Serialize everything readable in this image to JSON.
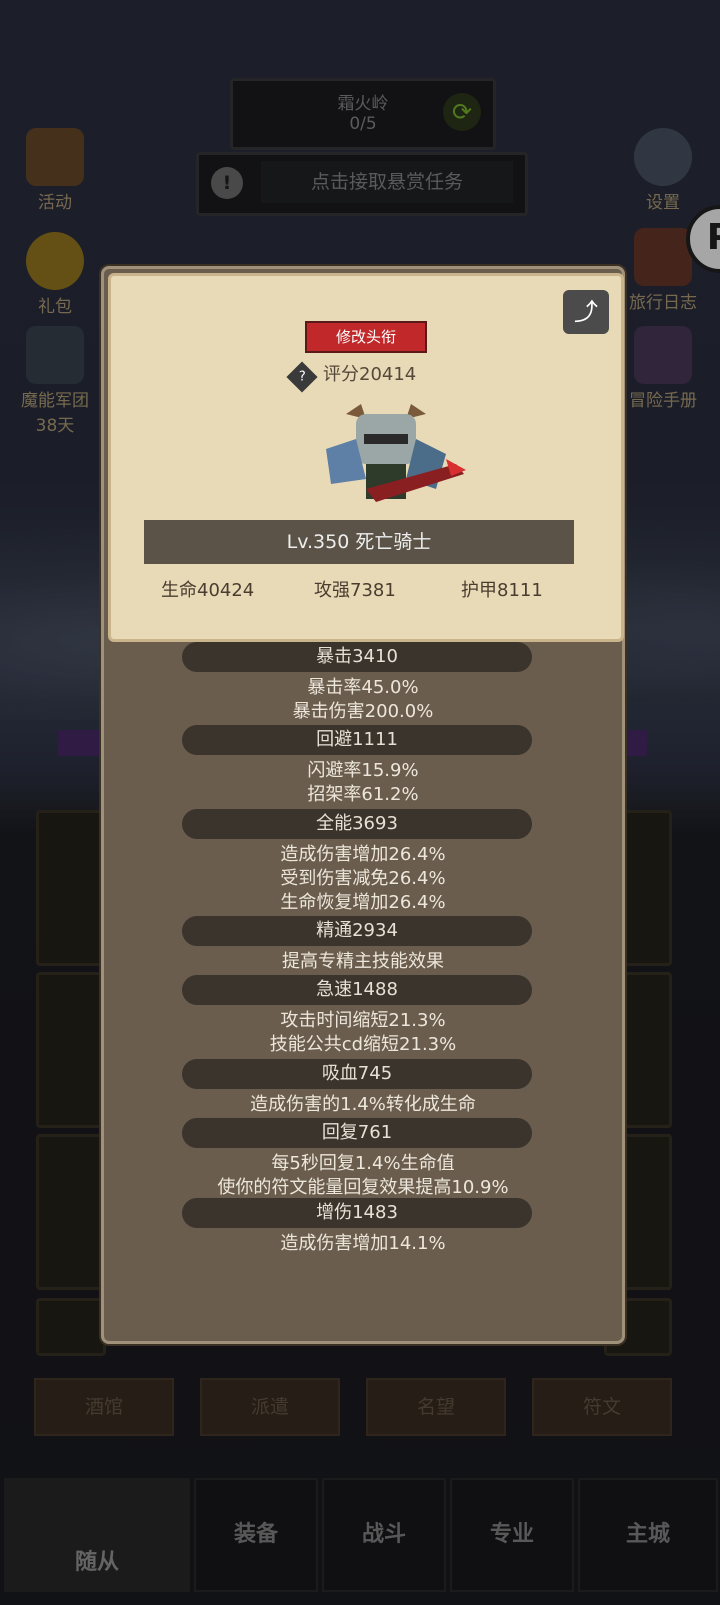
{
  "top": {
    "region": "霜火岭",
    "progress": "0/5",
    "quest": "点击接取悬赏任务"
  },
  "left_icons": [
    {
      "label": "活动"
    },
    {
      "label": "礼包"
    },
    {
      "label": "魔能军团",
      "sub": "38天"
    }
  ],
  "right_icons": [
    {
      "label": "设置"
    },
    {
      "label": "旅行日志"
    },
    {
      "label": "冒险手册"
    }
  ],
  "card": {
    "title_button": "修改头衔",
    "score": "评分20414",
    "level_name": "Lv.350 死亡骑士",
    "hp": "生命40424",
    "attack": "攻强7381",
    "armor": "护甲8111"
  },
  "sections": [
    {
      "title": "暴击3410",
      "lines": [
        "暴击率45.0%",
        "暴击伤害200.0%"
      ]
    },
    {
      "title": "回避1111",
      "lines": [
        "闪避率15.9%",
        "招架率61.2%"
      ]
    },
    {
      "title": "全能3693",
      "lines": [
        "造成伤害增加26.4%",
        "受到伤害减免26.4%",
        "生命恢复增加26.4%"
      ]
    },
    {
      "title": "精通2934",
      "lines": [
        "提高专精主技能效果"
      ]
    },
    {
      "title": "急速1488",
      "lines": [
        "攻击时间缩短21.3%",
        "技能公共cd缩短21.3%"
      ]
    },
    {
      "title": "吸血745",
      "lines": [
        "造成伤害的1.4%转化成生命"
      ]
    },
    {
      "title": "回复761",
      "lines": [
        "每5秒回复1.4%生命值",
        "使你的符文能量回复效果提高10.9%"
      ]
    },
    {
      "title": "增伤1483",
      "lines": [
        "造成伤害增加14.1%"
      ]
    }
  ],
  "tabs": [
    "酒馆",
    "派遣",
    "名望",
    "符文"
  ],
  "nav": [
    "随从",
    "装备",
    "战斗",
    "专业",
    "主城"
  ]
}
